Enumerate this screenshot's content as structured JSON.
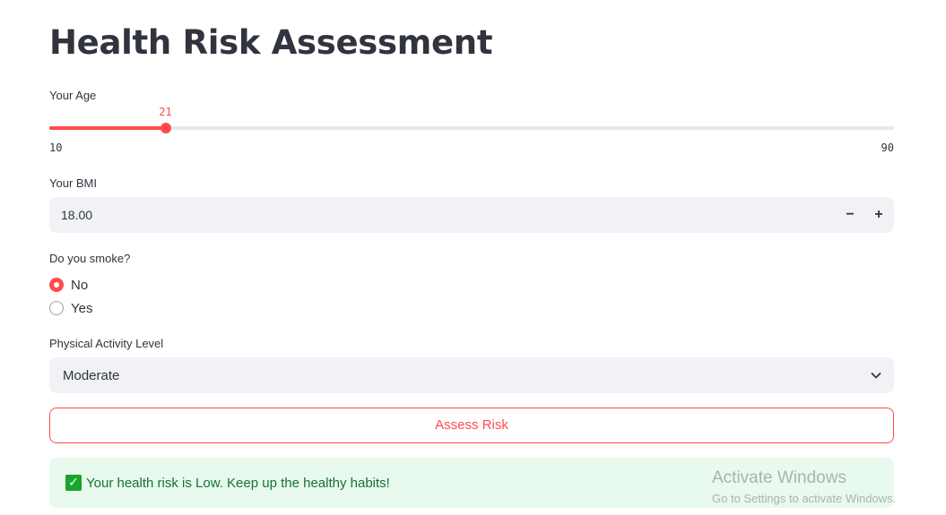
{
  "page": {
    "title": "Health Risk Assessment"
  },
  "age": {
    "label": "Your Age",
    "value": "21",
    "min": "10",
    "max": "90"
  },
  "bmi": {
    "label": "Your BMI",
    "value": "18.00",
    "decrement_symbol": "−",
    "increment_symbol": "+"
  },
  "smoke": {
    "label": "Do you smoke?",
    "options": [
      {
        "label": "No",
        "selected": true
      },
      {
        "label": "Yes",
        "selected": false
      }
    ]
  },
  "activity": {
    "label": "Physical Activity Level",
    "selected": "Moderate"
  },
  "actions": {
    "assess_label": "Assess Risk"
  },
  "result": {
    "message": "Your health risk is Low. Keep up the healthy habits!",
    "icon": "check-mark-icon"
  },
  "watermark": {
    "title": "Activate Windows",
    "subtitle": "Go to Settings to activate Windows."
  },
  "colors": {
    "accent": "#ff4b4b",
    "text": "#31333f",
    "input_bg": "#f0f2f6",
    "success_bg": "#e8f9ee",
    "success_text": "#177233"
  }
}
